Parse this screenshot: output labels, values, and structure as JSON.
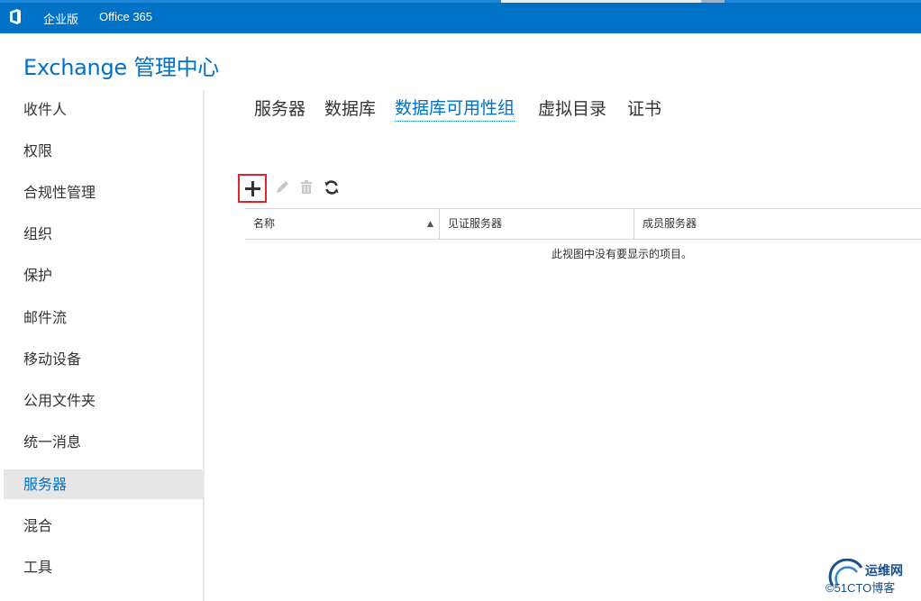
{
  "topbar": {
    "enterprise_label": "企业版",
    "office365_label": "Office 365",
    "brand_color": "#0072c6"
  },
  "app": {
    "title": "Exchange 管理中心"
  },
  "leftnav": {
    "items": [
      {
        "label": "收件人",
        "active": false
      },
      {
        "label": "权限",
        "active": false
      },
      {
        "label": "合规性管理",
        "active": false
      },
      {
        "label": "组织",
        "active": false
      },
      {
        "label": "保护",
        "active": false
      },
      {
        "label": "邮件流",
        "active": false
      },
      {
        "label": "移动设备",
        "active": false
      },
      {
        "label": "公用文件夹",
        "active": false
      },
      {
        "label": "统一消息",
        "active": false
      },
      {
        "label": "服务器",
        "active": true
      },
      {
        "label": "混合",
        "active": false
      },
      {
        "label": "工具",
        "active": false
      }
    ]
  },
  "tabs": [
    {
      "label": "服务器",
      "active": false
    },
    {
      "label": "数据库",
      "active": false
    },
    {
      "label": "数据库可用性组",
      "active": true
    },
    {
      "label": "虚拟目录",
      "active": false
    },
    {
      "label": "证书",
      "active": false
    }
  ],
  "toolbar": {
    "icons": [
      "add-icon",
      "edit-icon",
      "delete-icon",
      "refresh-icon"
    ],
    "highlight_color": "#e0242b"
  },
  "grid": {
    "columns": [
      "名称",
      "见证服务器",
      "成员服务器"
    ],
    "sort_column": "名称",
    "sort_direction": "ascending",
    "empty_message": "此视图中没有要显示的项目。"
  },
  "watermark": {
    "name": "运维网",
    "url": "©51CTO博客"
  }
}
